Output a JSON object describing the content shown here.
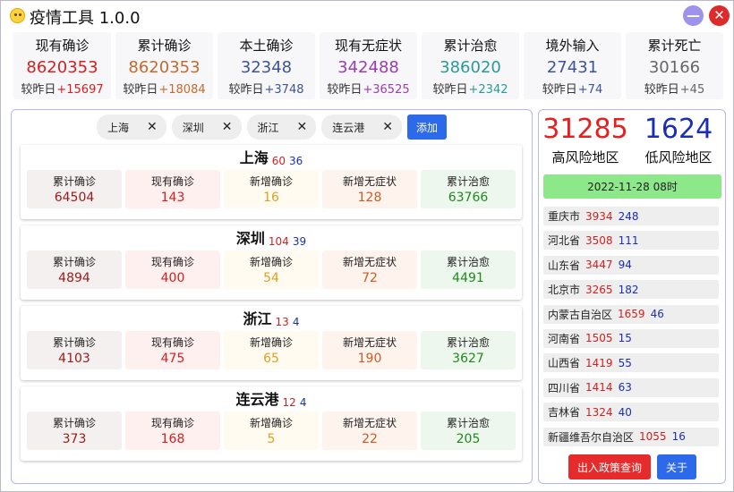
{
  "window": {
    "title": "疫情工具 1.0.0"
  },
  "stats": [
    {
      "label": "现有确诊",
      "value": "8620353",
      "delta_prefix": "较昨日",
      "delta": "+15697",
      "color": "#d42020",
      "delta_color": "#d42020"
    },
    {
      "label": "累计确诊",
      "value": "8620353",
      "delta_prefix": "较昨日",
      "delta": "+18084",
      "color": "#c56a2d",
      "delta_color": "#c56a2d"
    },
    {
      "label": "本土确诊",
      "value": "32348",
      "delta_prefix": "较昨日",
      "delta": "+3748",
      "color": "#3d5592",
      "delta_color": "#3d5592"
    },
    {
      "label": "现有无症状",
      "value": "342488",
      "delta_prefix": "较昨日",
      "delta": "+36525",
      "color": "#9a3db0",
      "delta_color": "#9a3db0"
    },
    {
      "label": "累计治愈",
      "value": "386020",
      "delta_prefix": "较昨日",
      "delta": "+2342",
      "color": "#2a9a96",
      "delta_color": "#2a9a96"
    },
    {
      "label": "境外输入",
      "value": "27431",
      "delta_prefix": "较昨日",
      "delta": "+74",
      "color": "#3d5592",
      "delta_color": "#3d5592"
    },
    {
      "label": "累计死亡",
      "value": "30166",
      "delta_prefix": "较昨日",
      "delta": "+45",
      "color": "#666666",
      "delta_color": "#666666"
    }
  ],
  "chips": [
    {
      "label": "上海",
      "close": "✕"
    },
    {
      "label": "深圳",
      "close": "✕"
    },
    {
      "label": "浙江",
      "close": "✕"
    },
    {
      "label": "连云港",
      "close": "✕"
    }
  ],
  "add_label": "添加",
  "cell_labels": [
    "累计确诊",
    "现有确诊",
    "新增确诊",
    "新增无症状",
    "累计治愈"
  ],
  "cell_styles": [
    {
      "bg": "#f5f0f0",
      "color": "#9a1b1b"
    },
    {
      "bg": "#fff0f0",
      "color": "#d42020"
    },
    {
      "bg": "#fffbf0",
      "color": "#e0a020"
    },
    {
      "bg": "#fff3ee",
      "color": "#d05a20"
    },
    {
      "bg": "#eef7ee",
      "color": "#1f8a1f"
    }
  ],
  "cities": [
    {
      "name": "上海",
      "high": "60",
      "low": "36",
      "values": [
        "64504",
        "143",
        "16",
        "128",
        "63766"
      ]
    },
    {
      "name": "深圳",
      "high": "104",
      "low": "39",
      "values": [
        "4894",
        "400",
        "54",
        "72",
        "4491"
      ]
    },
    {
      "name": "浙江",
      "high": "13",
      "low": "4",
      "values": [
        "4103",
        "475",
        "65",
        "190",
        "3627"
      ]
    },
    {
      "name": "连云港",
      "high": "12",
      "low": "4",
      "values": [
        "373",
        "168",
        "5",
        "22",
        "205"
      ]
    }
  ],
  "risk": {
    "high_count": "31285",
    "high_label": "高风险地区",
    "high_color": "#e52020",
    "low_count": "1624",
    "low_label": "低风险地区",
    "low_color": "#1a2fb5"
  },
  "update_time": "2022-11-28 08时",
  "provinces": [
    {
      "name": "重庆市",
      "high": "3934",
      "low": "248"
    },
    {
      "name": "河北省",
      "high": "3508",
      "low": "111"
    },
    {
      "name": "山东省",
      "high": "3447",
      "low": "94"
    },
    {
      "name": "北京市",
      "high": "3265",
      "low": "182"
    },
    {
      "name": "内蒙古自治区",
      "high": "1659",
      "low": "46"
    },
    {
      "name": "河南省",
      "high": "1505",
      "low": "15"
    },
    {
      "name": "山西省",
      "high": "1419",
      "low": "55"
    },
    {
      "name": "四川省",
      "high": "1414",
      "low": "63"
    },
    {
      "name": "吉林省",
      "high": "1324",
      "low": "40"
    },
    {
      "name": "新疆维吾尔自治区",
      "high": "1055",
      "low": "16"
    }
  ],
  "buttons": {
    "policy": "出入政策查询",
    "about": "关于"
  },
  "icons": {
    "app": "smiley-icon",
    "minimize": "minimize-icon",
    "close": "close-icon"
  },
  "colors": {
    "accent_blue": "#2d6ae9",
    "danger_red": "#e52b2b",
    "panel_border": "#b6b6f0",
    "update_green": "#8de88a"
  }
}
